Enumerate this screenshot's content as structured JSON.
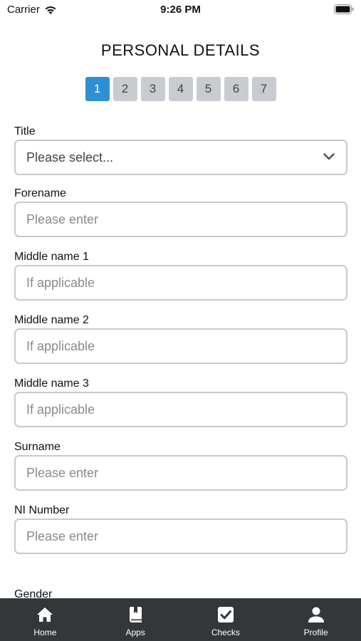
{
  "status_bar": {
    "carrier": "Carrier",
    "time": "9:26 PM"
  },
  "page": {
    "title": "PERSONAL DETAILS"
  },
  "steps": [
    "1",
    "2",
    "3",
    "4",
    "5",
    "6",
    "7"
  ],
  "active_step": "1",
  "form": {
    "title": {
      "label": "Title",
      "value": "Please select..."
    },
    "forename": {
      "label": "Forename",
      "placeholder": "Please enter"
    },
    "middle1": {
      "label": "Middle name 1",
      "placeholder": "If applicable"
    },
    "middle2": {
      "label": "Middle name 2",
      "placeholder": "If applicable"
    },
    "middle3": {
      "label": "Middle name 3",
      "placeholder": "If applicable"
    },
    "surname": {
      "label": "Surname",
      "placeholder": "Please enter"
    },
    "ni": {
      "label": "NI Number",
      "placeholder": "Please enter"
    },
    "gender": {
      "label": "Gender"
    }
  },
  "tabbar": {
    "items": [
      {
        "label": "Home",
        "icon": "home-icon"
      },
      {
        "label": "Apps",
        "icon": "book-icon"
      },
      {
        "label": "Checks",
        "icon": "checkbox-icon"
      },
      {
        "label": "Profile",
        "icon": "person-icon"
      }
    ]
  },
  "colors": {
    "accent": "#2d8fd5",
    "step_inactive": "#c8ccd0",
    "tabbar_bg": "#33373a"
  }
}
